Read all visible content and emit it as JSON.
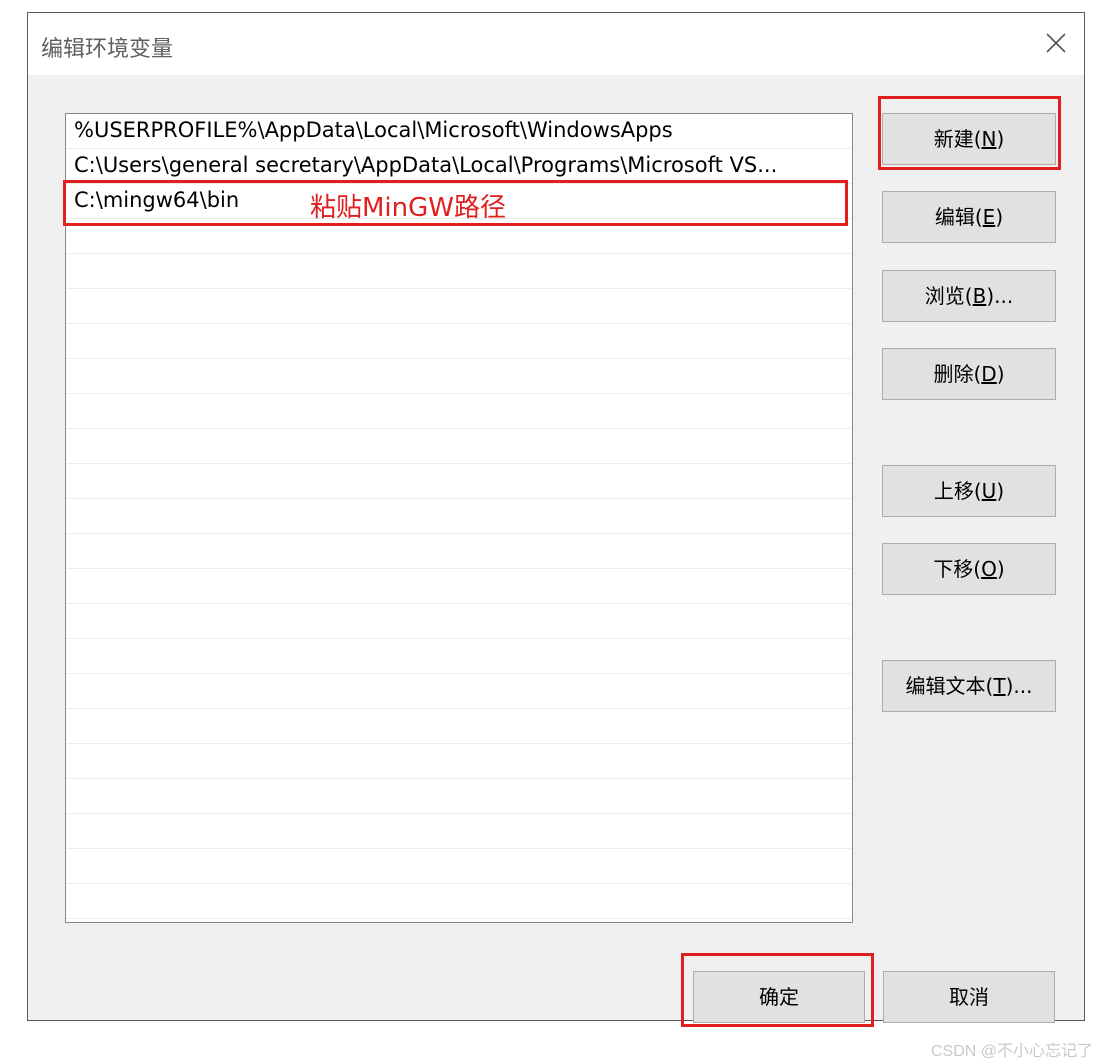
{
  "dialog": {
    "title": "编辑环境变量",
    "close_glyph": "×"
  },
  "path_list": {
    "items": [
      "%USERPROFILE%\\AppData\\Local\\Microsoft\\WindowsApps",
      "C:\\Users\\general secretary\\AppData\\Local\\Programs\\Microsoft VS...",
      "C:\\mingw64\\bin"
    ],
    "empty_rows": 20
  },
  "buttons": {
    "new": {
      "label": "新建(",
      "mnemonic": "N",
      "suffix": ")"
    },
    "edit": {
      "label": "编辑(",
      "mnemonic": "E",
      "suffix": ")"
    },
    "browse": {
      "label": "浏览(",
      "mnemonic": "B",
      "suffix": ")..."
    },
    "delete": {
      "label": "删除(",
      "mnemonic": "D",
      "suffix": ")"
    },
    "move_up": {
      "label": "上移(",
      "mnemonic": "U",
      "suffix": ")"
    },
    "move_down": {
      "label": "下移(",
      "mnemonic": "O",
      "suffix": ")"
    },
    "edit_text": {
      "label": "编辑文本(",
      "mnemonic": "T",
      "suffix": ")..."
    },
    "ok": "确定",
    "cancel": "取消"
  },
  "annotation": {
    "text": "粘贴MinGW路径",
    "color": "#e02020"
  },
  "watermark": "CSDN @不小心忘记了",
  "colors": {
    "dialog_bg": "#f0f0f0",
    "button_bg": "#e1e1e1",
    "annotation_red": "#e02020"
  }
}
